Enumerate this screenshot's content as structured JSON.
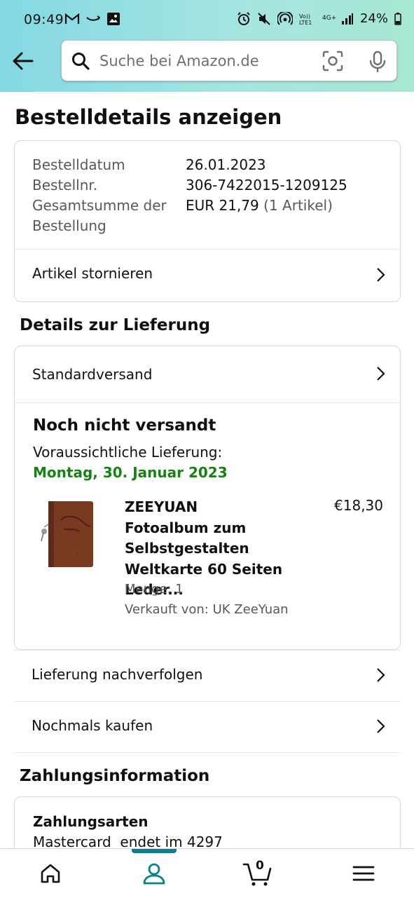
{
  "status_bar": {
    "time": "09:49",
    "battery": "24%",
    "network_label": "4G+"
  },
  "search": {
    "placeholder": "Suche bei Amazon.de"
  },
  "page_title": "Bestelldetails anzeigen",
  "order_summary": {
    "date_label": "Bestelldatum",
    "date_value": "26.01.2023",
    "number_label": "Bestellnr.",
    "number_value": "306-7422015-1209125",
    "total_label_line1": "Gesamtsumme der",
    "total_label_line2": "Bestellung",
    "total_value": "EUR 21,79",
    "total_items": "(1 Artikel)",
    "cancel_label": "Artikel stornieren"
  },
  "delivery": {
    "section_title": "Details zur Lieferung",
    "shipping_method": "Standardversand",
    "status": "Noch nicht versandt",
    "expected_label": "Voraussichtliche Lieferung:",
    "expected_date": "Montag, 30. Januar 2023",
    "product": {
      "title": "ZEEYUAN Fotoalbum zum Selbstgestalten Weltkarte 60 Seiten Leder...",
      "price": "€18,30",
      "quantity": "Menge: 1",
      "seller": "Verkauft von: UK ZeeYuan"
    },
    "track_label": "Lieferung nachverfolgen",
    "buy_again_label": "Nochmals kaufen"
  },
  "payment": {
    "section_title": "Zahlungsinformation",
    "methods_label": "Zahlungsarten",
    "method_value": "Mastercard  endet im 4297"
  },
  "bottom_nav": {
    "cart_count": "0"
  }
}
